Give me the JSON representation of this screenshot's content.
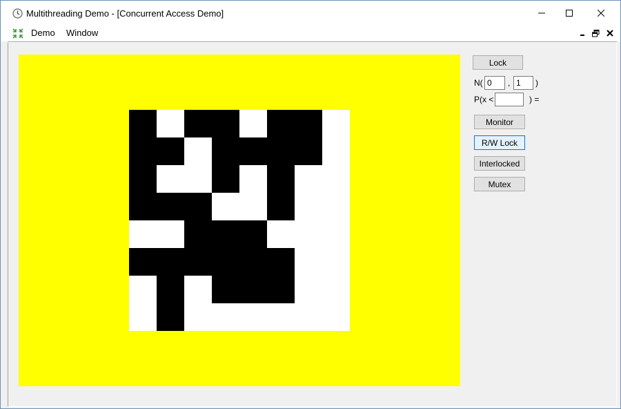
{
  "window": {
    "title": "Multithreading Demo - [Concurrent Access Demo]"
  },
  "menu": {
    "items": [
      {
        "label": "Demo"
      },
      {
        "label": "Window"
      }
    ]
  },
  "controls": {
    "lock_label": "Lock",
    "n_prefix": "N(",
    "n_sep": ",",
    "n_suffix": ")",
    "n_first_value": "0",
    "n_second_value": "1",
    "p_prefix": "P(x <",
    "p_suffix": ") =",
    "p_value": "",
    "monitor_label": "Monitor",
    "rwlock_label": "R/W Lock",
    "interlocked_label": "Interlocked",
    "mutex_label": "Mutex"
  },
  "canvas": {
    "background_color": "#ffff00",
    "on_color": "#000000",
    "off_color": "#ffffff",
    "grid": [
      [
        1,
        0,
        1,
        1,
        0,
        1,
        1,
        0
      ],
      [
        1,
        1,
        0,
        1,
        1,
        1,
        1,
        0
      ],
      [
        1,
        0,
        0,
        1,
        0,
        1,
        0,
        0
      ],
      [
        1,
        1,
        1,
        0,
        0,
        1,
        0,
        0
      ],
      [
        0,
        0,
        1,
        1,
        1,
        0,
        0,
        0
      ],
      [
        1,
        1,
        1,
        1,
        1,
        1,
        0,
        0
      ],
      [
        0,
        1,
        0,
        1,
        1,
        1,
        0,
        0
      ],
      [
        0,
        1,
        0,
        0,
        0,
        0,
        0,
        0
      ]
    ]
  }
}
